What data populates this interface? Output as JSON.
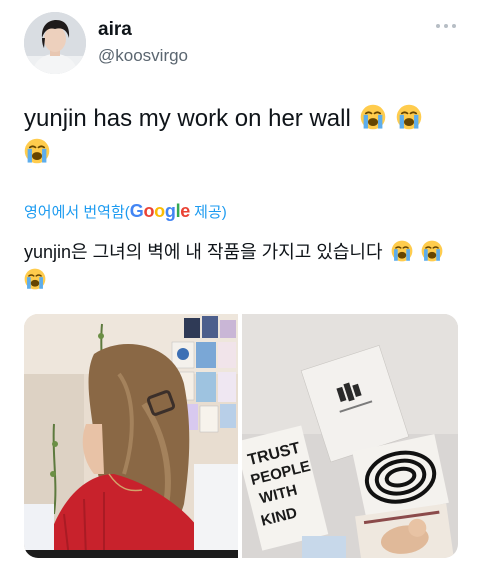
{
  "author": {
    "display_name": "aira",
    "handle": "@koosvirgo",
    "avatar_icon": "profile-photo"
  },
  "more_icon": "ellipsis-icon",
  "tweet": {
    "text": "yunjin has my work on her wall",
    "emoji_icon": "loudly-crying-face-emoji"
  },
  "translation": {
    "label_prefix": "영어에서 번역함(",
    "brand": "Google",
    "label_suffix": " 제공)",
    "text": "yunjin은 그녀의 벽에 내 작품을 가지고 있습니다"
  },
  "media": {
    "images": [
      "photo-girl-by-wall",
      "photo-wall-art-closeup"
    ]
  },
  "colors": {
    "link": "#1d9bf0",
    "text": "#0f1419",
    "secondary": "#5b6670"
  }
}
